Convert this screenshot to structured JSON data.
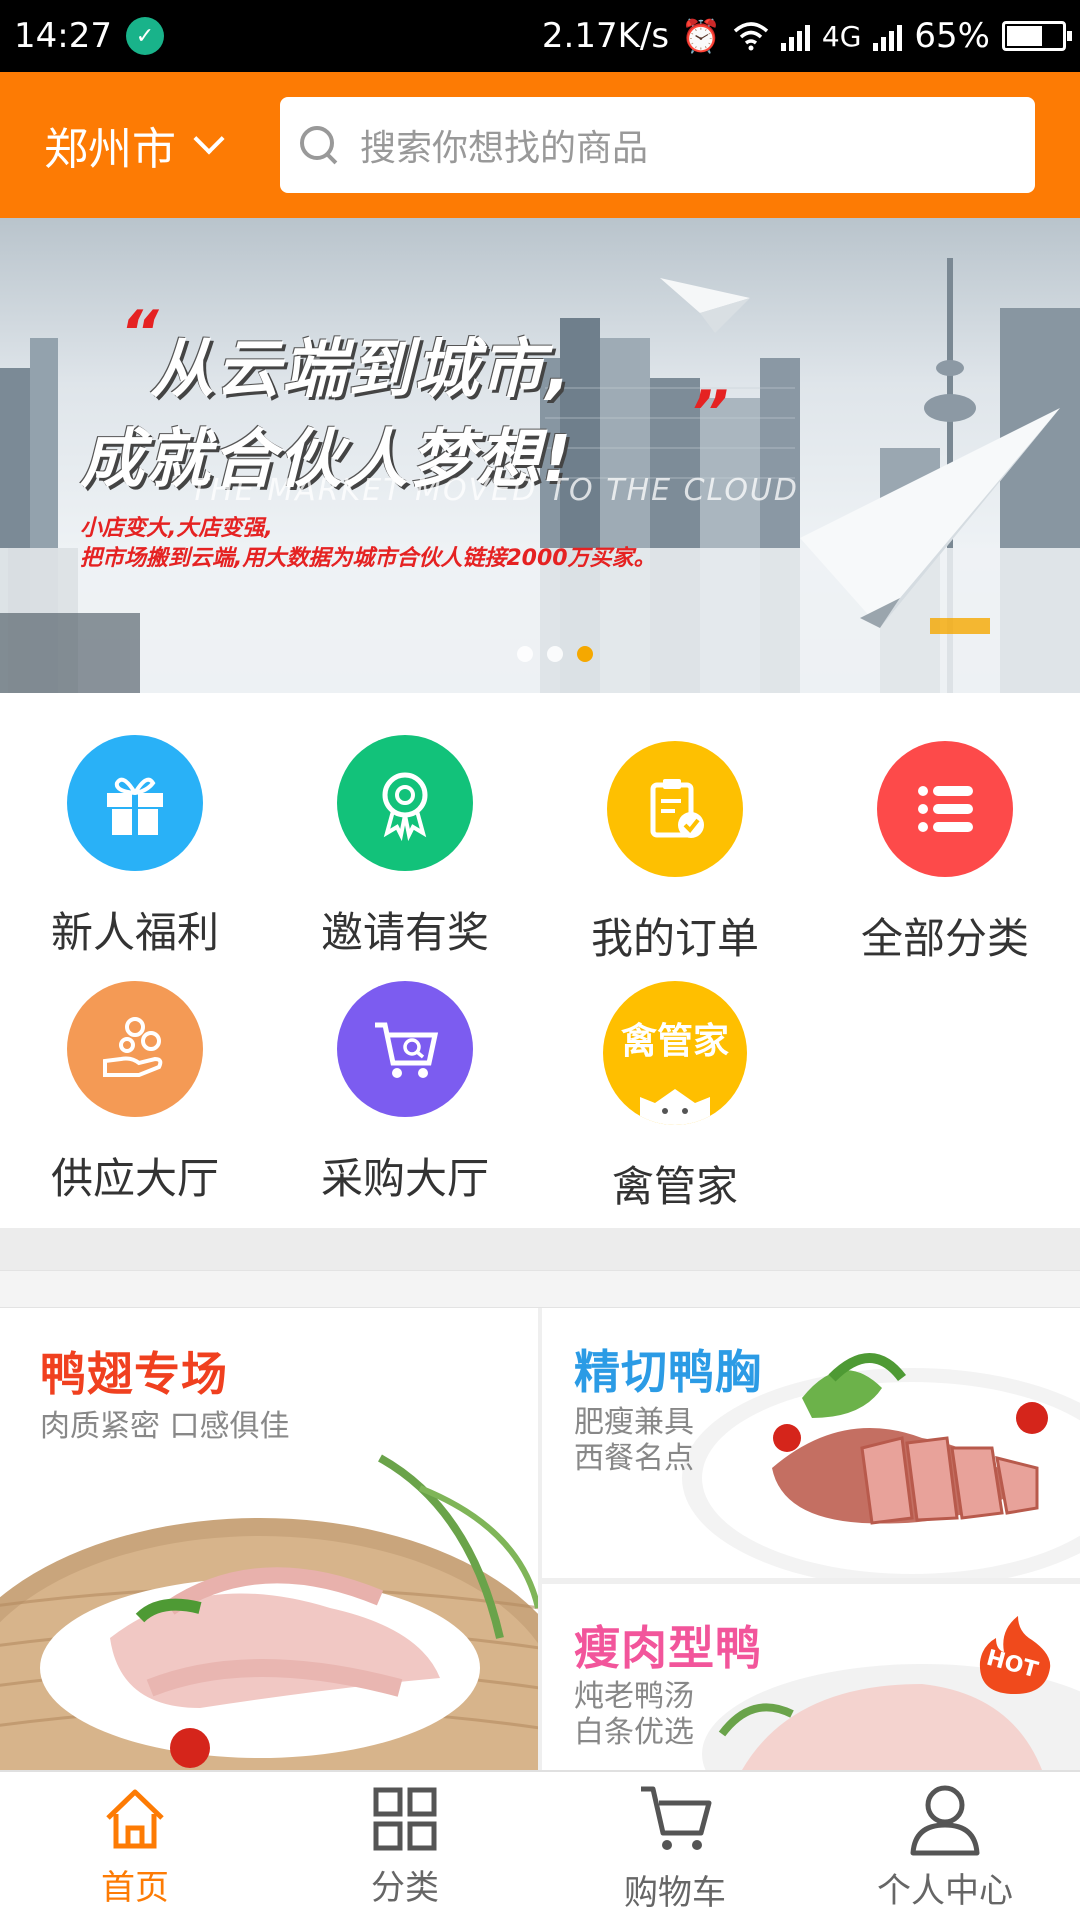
{
  "status_bar": {
    "time": "14:27",
    "speed": "2.17K/s",
    "network": "4G",
    "battery": "65%",
    "battery_level": 0.65
  },
  "header": {
    "city": "郑州市",
    "search_placeholder": "搜索你想找的商品"
  },
  "banner": {
    "headline_line1": "从云端到城市,",
    "headline_line2": "成就合伙人梦想!",
    "english": "THE MARKET MOVED TO THE CLOUD",
    "sub_line1": "小店变大,大店变强,",
    "sub_line2": "把市场搬到云端,用大数据为城市合伙人链接2000万买家。",
    "slide_count": 3,
    "active_slide": 3
  },
  "icons": [
    {
      "label": "新人福利",
      "icon": "gift-icon",
      "color": "#29b1f7"
    },
    {
      "label": "邀请有奖",
      "icon": "award-icon",
      "color": "#12c27a"
    },
    {
      "label": "我的订单",
      "icon": "clipboard-icon",
      "color": "#fec001"
    },
    {
      "label": "全部分类",
      "icon": "list-icon",
      "color": "#fd4a4a"
    },
    {
      "label": "供应大厅",
      "icon": "coins-hand-icon",
      "color": "#f49a55"
    },
    {
      "label": "采购大厅",
      "icon": "cart-search-icon",
      "color": "#7c5cf0"
    },
    {
      "label": "禽管家",
      "icon": "mascot-icon",
      "color": "#ffbf00",
      "badge_text": "禽管家"
    }
  ],
  "promos": [
    {
      "title": "鸭翅专场",
      "line1": "肉质紧密 口感俱佳",
      "line2": "",
      "title_color": "#f0401f"
    },
    {
      "title": "精切鸭胸",
      "line1": "肥瘦兼具",
      "line2": "西餐名点",
      "title_color": "#2b9be5"
    },
    {
      "title": "瘦肉型鸭",
      "line1": "炖老鸭汤",
      "line2": "白条优选",
      "title_color": "#f2559b",
      "badge": "HOT"
    }
  ],
  "nav": [
    {
      "label": "首页",
      "icon": "home-icon",
      "active": true
    },
    {
      "label": "分类",
      "icon": "grid-icon",
      "active": false
    },
    {
      "label": "购物车",
      "icon": "cart-icon",
      "active": false
    },
    {
      "label": "个人中心",
      "icon": "person-icon",
      "active": false
    }
  ],
  "colors": {
    "accent": "#fd7b04"
  }
}
